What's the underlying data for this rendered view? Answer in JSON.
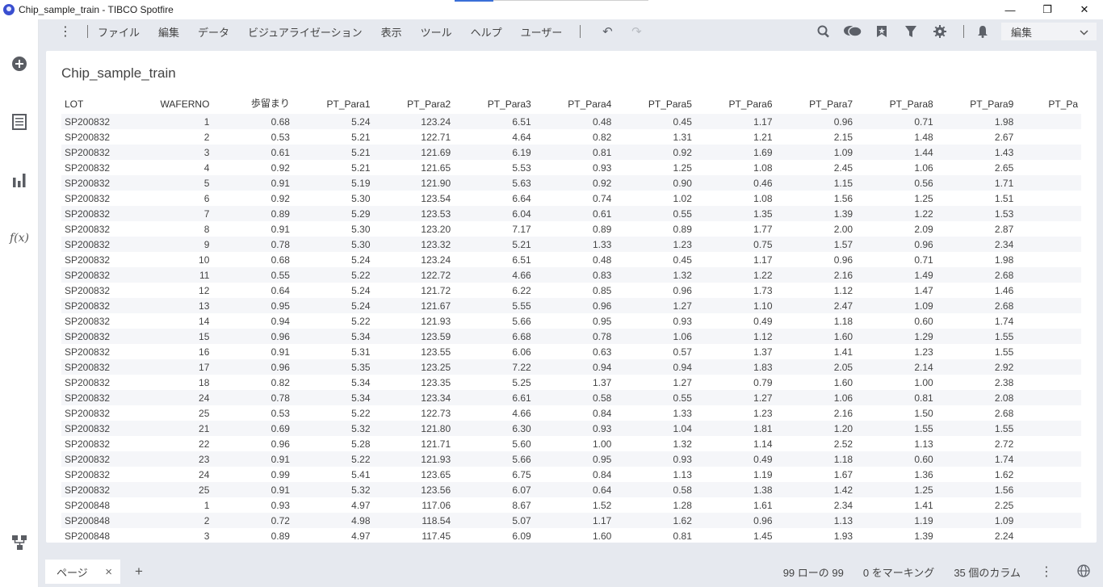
{
  "window": {
    "title": "Chip_sample_train - TIBCO Spotfire",
    "minimize": "—",
    "restore": "❐",
    "close": "✕"
  },
  "menu": {
    "items": [
      "ファイル",
      "編集",
      "データ",
      "ビジュアライゼーション",
      "表示",
      "ツール",
      "ヘルプ",
      "ユーザー"
    ],
    "mode": "編集"
  },
  "icons": {
    "kebab": "kebab-icon",
    "undo": "undo-icon",
    "redo": "redo-icon",
    "search": "search-icon",
    "collab": "comments-icon",
    "bookmark": "bookmark-icon",
    "filter": "filter-icon",
    "settings": "gear-icon",
    "notifications": "bell-icon"
  },
  "visual": {
    "title": "Chip_sample_train",
    "columns": [
      "LOT",
      "WAFERNO",
      "歩留まり",
      "PT_Para1",
      "PT_Para2",
      "PT_Para3",
      "PT_Para4",
      "PT_Para5",
      "PT_Para6",
      "PT_Para7",
      "PT_Para8",
      "PT_Para9",
      "PT_Pa"
    ],
    "rows": [
      [
        "SP200832",
        "1",
        "0.68",
        "5.24",
        "123.24",
        "6.51",
        "0.48",
        "0.45",
        "1.17",
        "0.96",
        "0.71",
        "1.98"
      ],
      [
        "SP200832",
        "2",
        "0.53",
        "5.21",
        "122.71",
        "4.64",
        "0.82",
        "1.31",
        "1.21",
        "2.15",
        "1.48",
        "2.67"
      ],
      [
        "SP200832",
        "3",
        "0.61",
        "5.21",
        "121.69",
        "6.19",
        "0.81",
        "0.92",
        "1.69",
        "1.09",
        "1.44",
        "1.43"
      ],
      [
        "SP200832",
        "4",
        "0.92",
        "5.21",
        "121.65",
        "5.53",
        "0.93",
        "1.25",
        "1.08",
        "2.45",
        "1.06",
        "2.65"
      ],
      [
        "SP200832",
        "5",
        "0.91",
        "5.19",
        "121.90",
        "5.63",
        "0.92",
        "0.90",
        "0.46",
        "1.15",
        "0.56",
        "1.71"
      ],
      [
        "SP200832",
        "6",
        "0.92",
        "5.30",
        "123.54",
        "6.64",
        "0.74",
        "1.02",
        "1.08",
        "1.56",
        "1.25",
        "1.51"
      ],
      [
        "SP200832",
        "7",
        "0.89",
        "5.29",
        "123.53",
        "6.04",
        "0.61",
        "0.55",
        "1.35",
        "1.39",
        "1.22",
        "1.53"
      ],
      [
        "SP200832",
        "8",
        "0.91",
        "5.30",
        "123.20",
        "7.17",
        "0.89",
        "0.89",
        "1.77",
        "2.00",
        "2.09",
        "2.87"
      ],
      [
        "SP200832",
        "9",
        "0.78",
        "5.30",
        "123.32",
        "5.21",
        "1.33",
        "1.23",
        "0.75",
        "1.57",
        "0.96",
        "2.34"
      ],
      [
        "SP200832",
        "10",
        "0.68",
        "5.24",
        "123.24",
        "6.51",
        "0.48",
        "0.45",
        "1.17",
        "0.96",
        "0.71",
        "1.98"
      ],
      [
        "SP200832",
        "11",
        "0.55",
        "5.22",
        "122.72",
        "4.66",
        "0.83",
        "1.32",
        "1.22",
        "2.16",
        "1.49",
        "2.68"
      ],
      [
        "SP200832",
        "12",
        "0.64",
        "5.24",
        "121.72",
        "6.22",
        "0.85",
        "0.96",
        "1.73",
        "1.12",
        "1.47",
        "1.46"
      ],
      [
        "SP200832",
        "13",
        "0.95",
        "5.24",
        "121.67",
        "5.55",
        "0.96",
        "1.27",
        "1.10",
        "2.47",
        "1.09",
        "2.68"
      ],
      [
        "SP200832",
        "14",
        "0.94",
        "5.22",
        "121.93",
        "5.66",
        "0.95",
        "0.93",
        "0.49",
        "1.18",
        "0.60",
        "1.74"
      ],
      [
        "SP200832",
        "15",
        "0.96",
        "5.34",
        "123.59",
        "6.68",
        "0.78",
        "1.06",
        "1.12",
        "1.60",
        "1.29",
        "1.55"
      ],
      [
        "SP200832",
        "16",
        "0.91",
        "5.31",
        "123.55",
        "6.06",
        "0.63",
        "0.57",
        "1.37",
        "1.41",
        "1.23",
        "1.55"
      ],
      [
        "SP200832",
        "17",
        "0.96",
        "5.35",
        "123.25",
        "7.22",
        "0.94",
        "0.94",
        "1.83",
        "2.05",
        "2.14",
        "2.92"
      ],
      [
        "SP200832",
        "18",
        "0.82",
        "5.34",
        "123.35",
        "5.25",
        "1.37",
        "1.27",
        "0.79",
        "1.60",
        "1.00",
        "2.38"
      ],
      [
        "SP200832",
        "24",
        "0.78",
        "5.34",
        "123.34",
        "6.61",
        "0.58",
        "0.55",
        "1.27",
        "1.06",
        "0.81",
        "2.08"
      ],
      [
        "SP200832",
        "25",
        "0.53",
        "5.22",
        "122.73",
        "4.66",
        "0.84",
        "1.33",
        "1.23",
        "2.16",
        "1.50",
        "2.68"
      ],
      [
        "SP200832",
        "21",
        "0.69",
        "5.32",
        "121.80",
        "6.30",
        "0.93",
        "1.04",
        "1.81",
        "1.20",
        "1.55",
        "1.55"
      ],
      [
        "SP200832",
        "22",
        "0.96",
        "5.28",
        "121.71",
        "5.60",
        "1.00",
        "1.32",
        "1.14",
        "2.52",
        "1.13",
        "2.72"
      ],
      [
        "SP200832",
        "23",
        "0.91",
        "5.22",
        "121.93",
        "5.66",
        "0.95",
        "0.93",
        "0.49",
        "1.18",
        "0.60",
        "1.74"
      ],
      [
        "SP200832",
        "24",
        "0.99",
        "5.41",
        "123.65",
        "6.75",
        "0.84",
        "1.13",
        "1.19",
        "1.67",
        "1.36",
        "1.62"
      ],
      [
        "SP200832",
        "25",
        "0.91",
        "5.32",
        "123.56",
        "6.07",
        "0.64",
        "0.58",
        "1.38",
        "1.42",
        "1.25",
        "1.56"
      ],
      [
        "SP200848",
        "1",
        "0.93",
        "4.97",
        "117.06",
        "8.67",
        "1.52",
        "1.28",
        "1.61",
        "2.34",
        "1.41",
        "2.25"
      ],
      [
        "SP200848",
        "2",
        "0.72",
        "4.98",
        "118.54",
        "5.07",
        "1.17",
        "1.62",
        "0.96",
        "1.13",
        "1.19",
        "1.09"
      ],
      [
        "SP200848",
        "3",
        "0.89",
        "4.97",
        "117.45",
        "6.09",
        "1.60",
        "0.81",
        "1.45",
        "1.93",
        "1.39",
        "2.24"
      ]
    ]
  },
  "footer": {
    "page_tab": "ページ",
    "page_close": "×",
    "add_page": "+",
    "rows_status": "99 ローの 99",
    "marking_status": "0 をマーキング",
    "columns_status": "35 個のカラム"
  },
  "colors": {
    "accent": "#3a4fd0",
    "frame": "#e6e9ef",
    "row_alt": "#f5f6f9"
  }
}
